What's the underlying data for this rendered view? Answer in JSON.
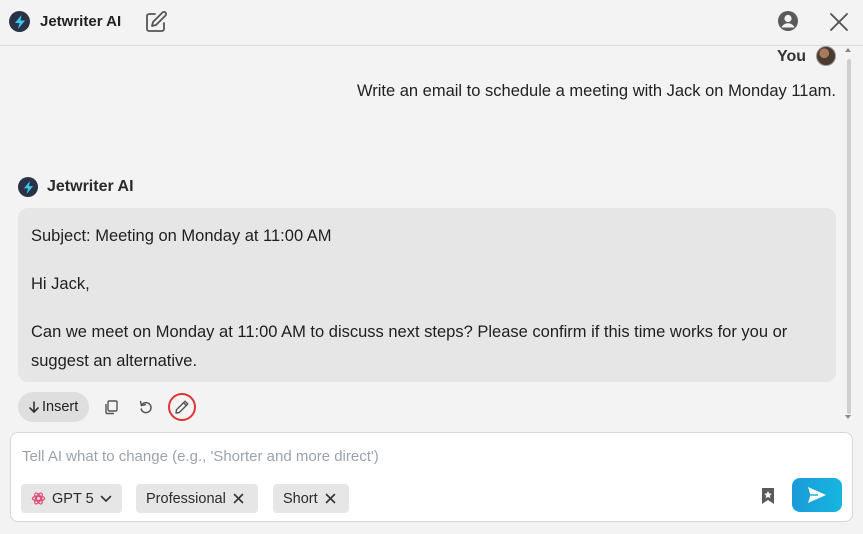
{
  "app": {
    "title": "Jetwriter AI"
  },
  "header": {
    "icons": {
      "logo": "bolt-logo-icon",
      "new_chat": "edit-square-icon",
      "account": "account-circle-icon",
      "close": "close-icon"
    }
  },
  "conversation": {
    "user": {
      "name": "You",
      "message": "Write an email to schedule a meeting with Jack on Monday 11am."
    },
    "assistant": {
      "name": "Jetwriter AI",
      "paragraphs": [
        "Subject: Meeting on Monday at 11:00 AM",
        "Hi Jack,",
        "Can we meet on Monday at 11:00 AM to discuss next steps? Please confirm if this time works for you or suggest an alternative."
      ]
    },
    "actions": {
      "insert_label": "Insert",
      "icons": [
        "copy-icon",
        "retry-icon",
        "edit-pencil-icon"
      ]
    }
  },
  "composer": {
    "placeholder": "Tell AI what to change (e.g., 'Shorter and more direct')",
    "value": "",
    "model": "GPT 5",
    "tone": "Professional",
    "length": "Short"
  },
  "colors": {
    "accent": "#16a6dc",
    "highlight": "#e03535",
    "logo_bg": "#2a3346",
    "bubble": "#e6e6e6"
  }
}
